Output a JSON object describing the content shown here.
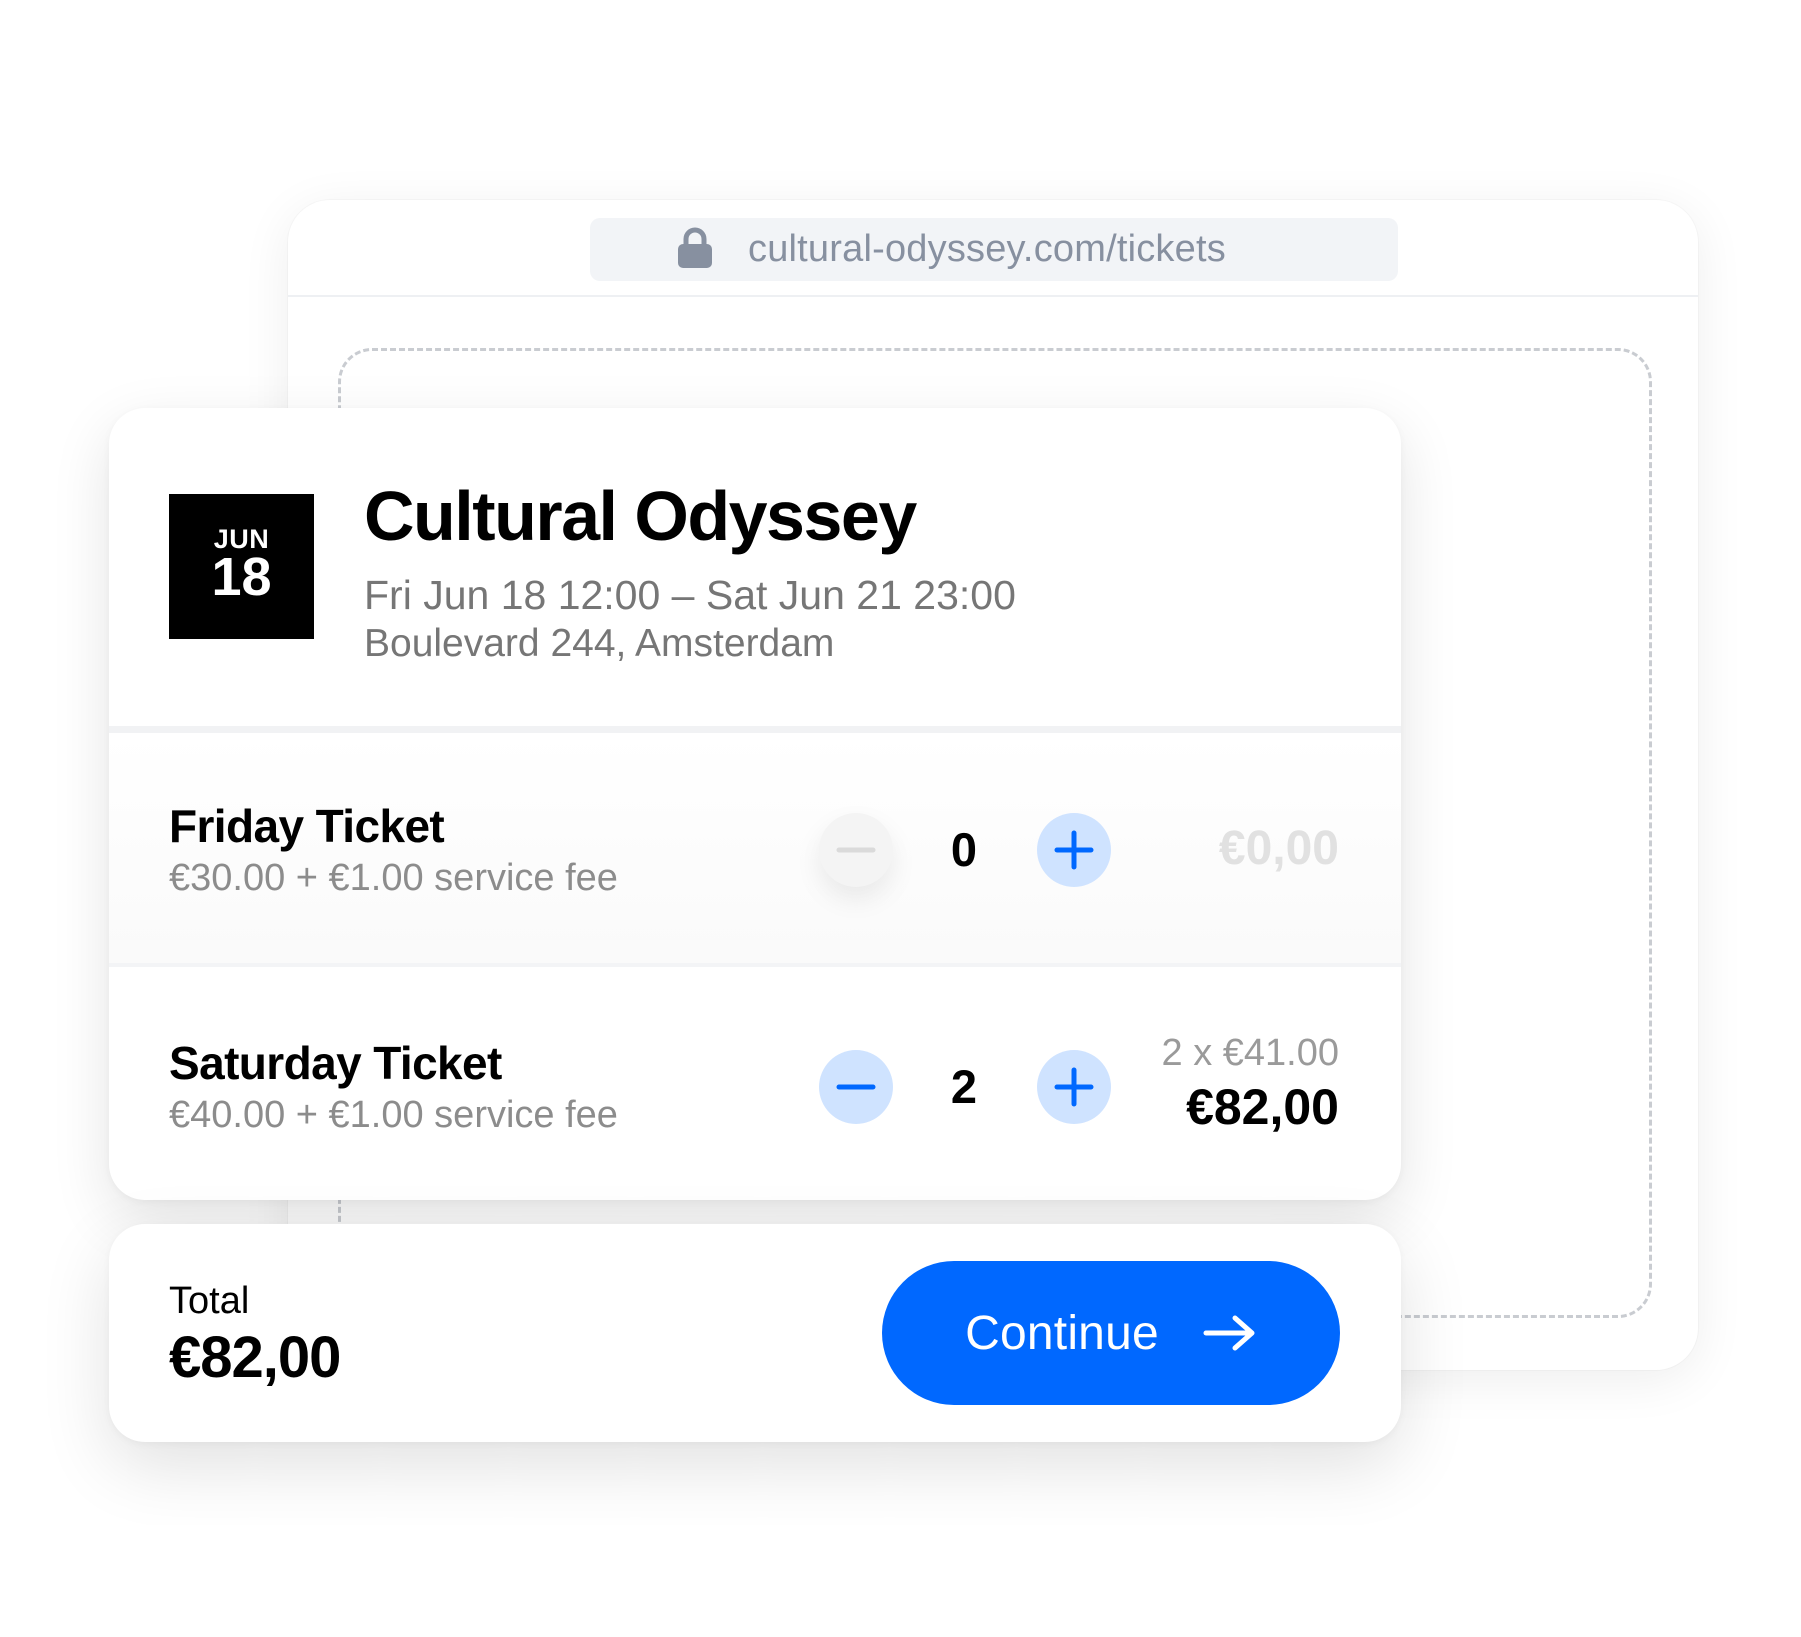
{
  "browser": {
    "url": "cultural-odyssey.com/tickets"
  },
  "event": {
    "month": "JUN",
    "day": "18",
    "title": "Cultural Odyssey",
    "datetime": "Fri Jun 18 12:00 – Sat Jun 21 23:00",
    "venue": "Boulevard 244, Amsterdam"
  },
  "tickets": [
    {
      "name": "Friday Ticket",
      "price": "€30.00 + €1.00 service fee",
      "quantity": "0",
      "breakdown": "",
      "subtotal": "€0,00"
    },
    {
      "name": "Saturday Ticket",
      "price": "€40.00 + €1.00 service fee",
      "quantity": "2",
      "breakdown": "2 x €41.00",
      "subtotal": "€82,00"
    }
  ],
  "summary": {
    "total_label": "Total",
    "total_value": "€82,00",
    "continue_label": "Continue"
  },
  "colors": {
    "accent": "#0068ff",
    "stepper_active_bg": "#cfe3ff",
    "muted_text": "#767676"
  },
  "icons": [
    "lock-icon",
    "minus-icon",
    "plus-icon",
    "arrow-right-icon"
  ]
}
